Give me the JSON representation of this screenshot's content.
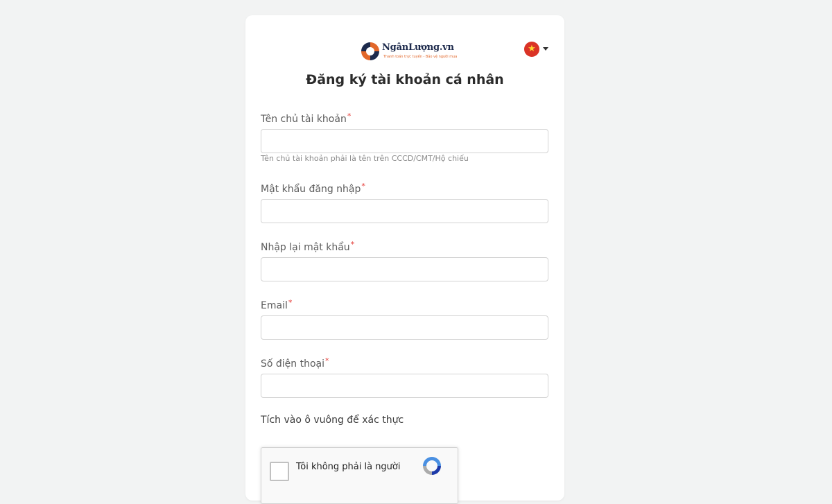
{
  "brand": {
    "name": "NgânLượng.vn",
    "tagline": "Thanh toán trực tuyến - Bảo vệ người mua"
  },
  "language": {
    "flag_icon": "vietnam-flag-icon",
    "caret_icon": "caret-down-icon"
  },
  "page": {
    "title": "Đăng ký tài khoản cá nhân"
  },
  "form": {
    "account_name": {
      "label": "Tên chủ tài khoản",
      "required_mark": "*",
      "value": "",
      "hint": "Tên chủ tài khoản phải là tên trên CCCD/CMT/Hộ chiếu"
    },
    "password": {
      "label": "Mật khẩu đăng nhập",
      "required_mark": "*",
      "value": ""
    },
    "confirm_password": {
      "label": "Nhập lại mật khẩu",
      "required_mark": "*",
      "value": ""
    },
    "email": {
      "label": "Email",
      "required_mark": "*",
      "value": ""
    },
    "phone": {
      "label": "Số điện thoại",
      "required_mark": "*",
      "value": ""
    },
    "verify": {
      "label": "Tích vào ô vuông để xác thực",
      "recaptcha_text": "Tôi không phải là người",
      "recaptcha_icon": "recaptcha-logo-icon"
    }
  },
  "colors": {
    "background": "#f2f3f3",
    "card": "#ffffff",
    "required": "#e53935",
    "brand_orange": "#e2672a",
    "brand_navy": "#1d2a4c",
    "flag_red": "#da3326",
    "flag_star": "#ffd531"
  }
}
